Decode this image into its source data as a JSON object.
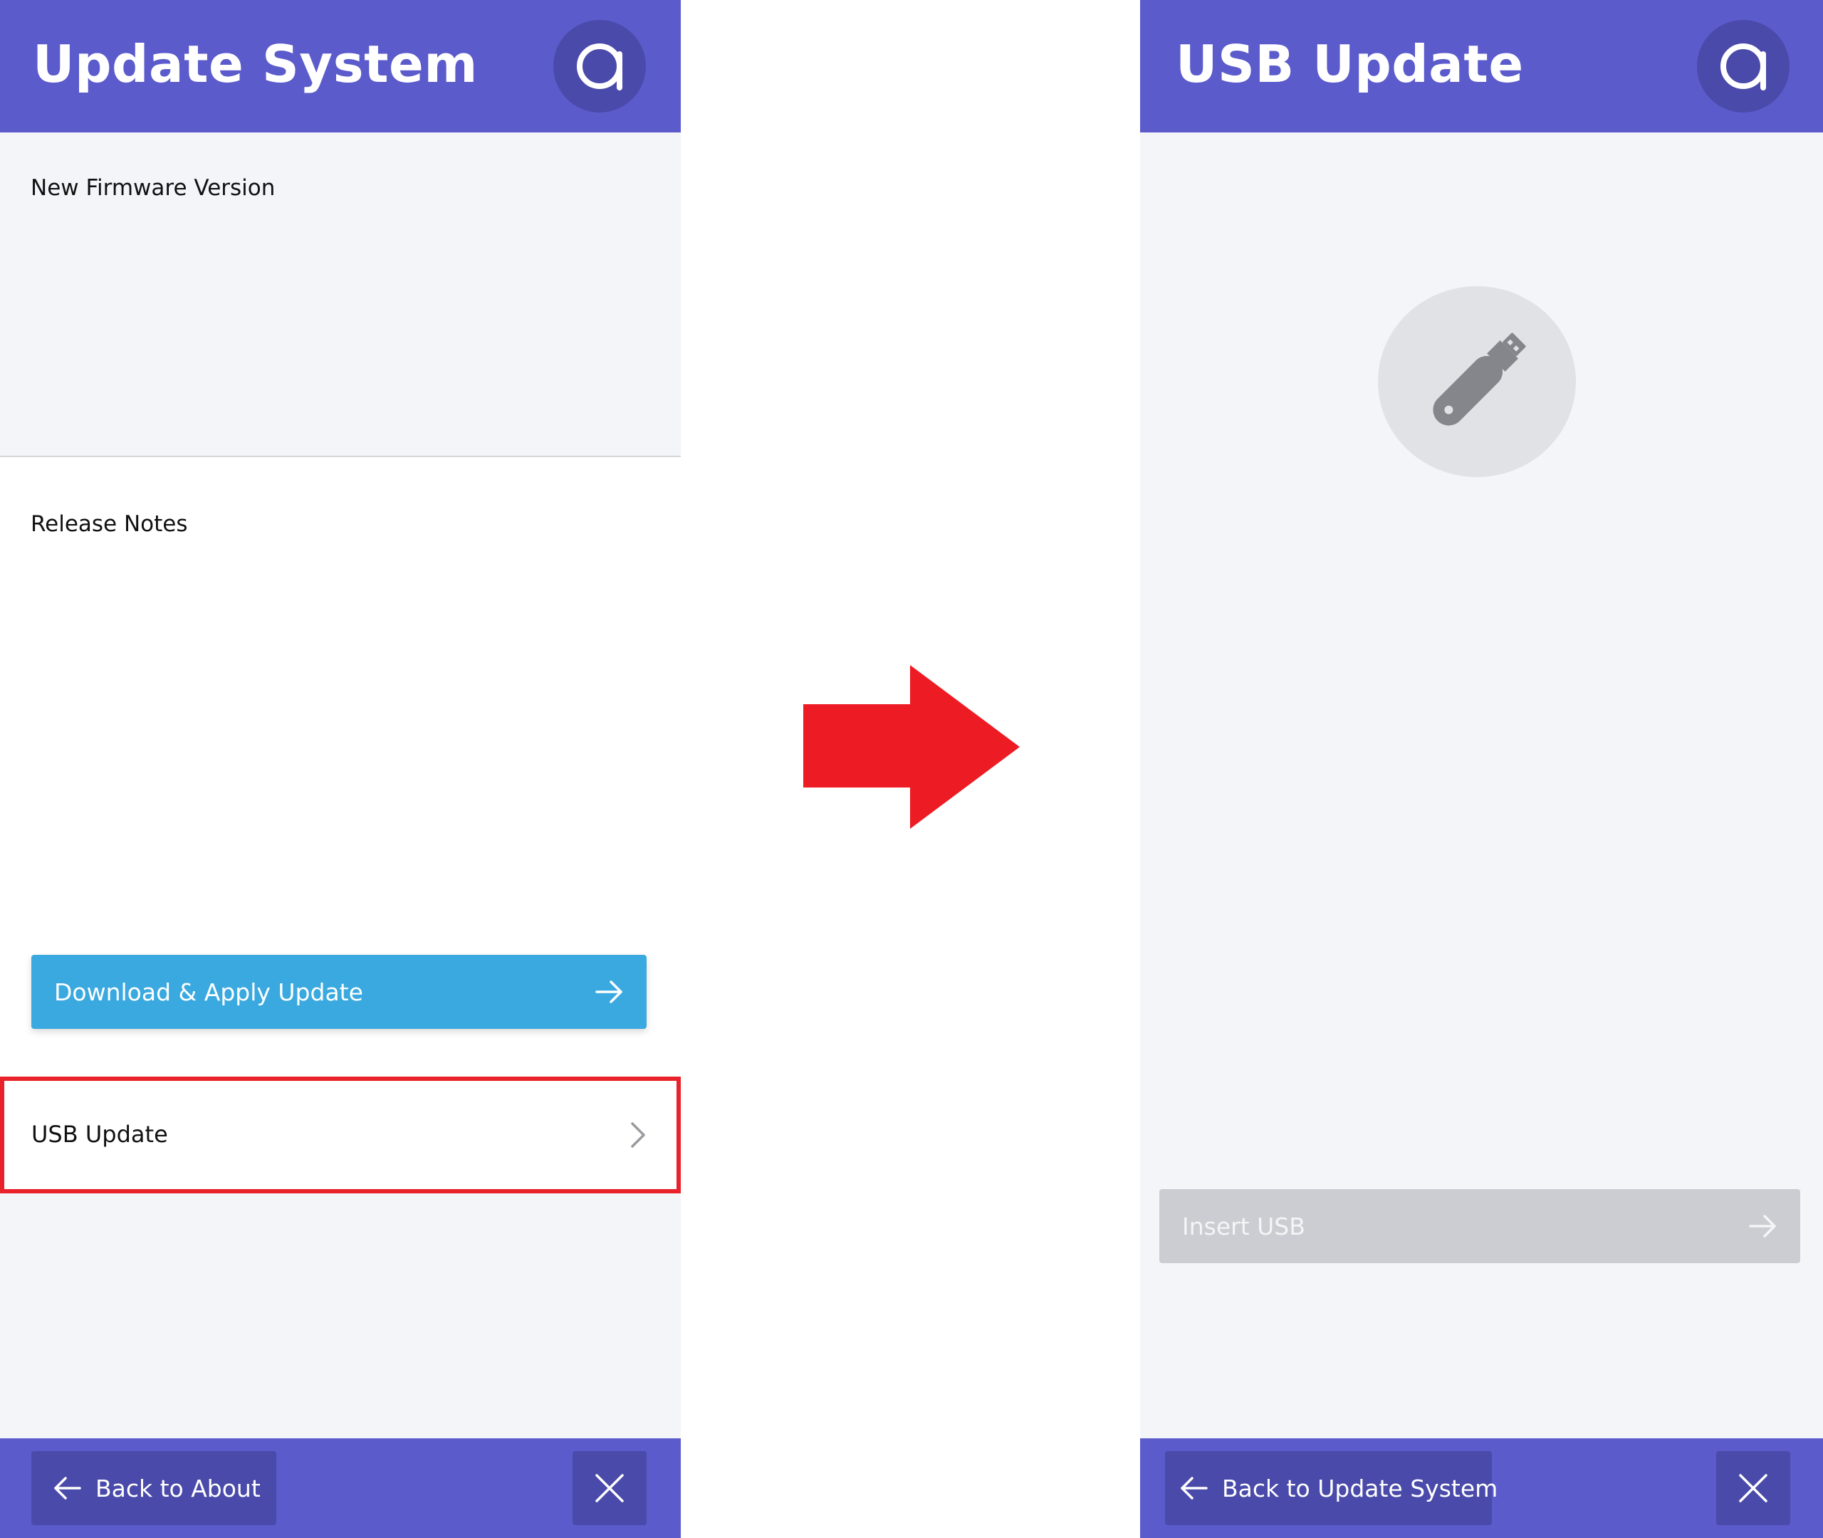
{
  "colors": {
    "header": "#5b5bcc",
    "header_button": "#4a4aaa",
    "primary_button": "#3aa9df",
    "disabled_button": "#cccdd2",
    "highlight": "#e8212b",
    "panel_background": "#f4f5f9"
  },
  "update_system_screen": {
    "header": {
      "title": "Update System",
      "logo_icon": "circle-a-logo-icon"
    },
    "firmware": {
      "label": "New Firmware Version"
    },
    "release_notes": {
      "label": "Release Notes"
    },
    "download_button": {
      "label": "Download & Apply Update",
      "icon": "arrow-right-icon"
    },
    "usb_row": {
      "label": "USB Update",
      "icon": "chevron-right-icon",
      "highlighted": true
    },
    "footer": {
      "back_label": "Back to About",
      "back_icon": "arrow-left-icon",
      "close_icon": "close-icon"
    }
  },
  "transition": {
    "icon": "arrow-right-icon",
    "color": "#ed1c24"
  },
  "usb_update_screen": {
    "header": {
      "title": "USB Update",
      "logo_icon": "circle-a-logo-icon"
    },
    "usb_icon": "usb-drive-icon",
    "insert_button": {
      "label": "Insert USB",
      "icon": "arrow-right-icon",
      "disabled": true
    },
    "footer": {
      "back_label": "Back to Update System",
      "back_icon": "arrow-left-icon",
      "close_icon": "close-icon"
    }
  }
}
